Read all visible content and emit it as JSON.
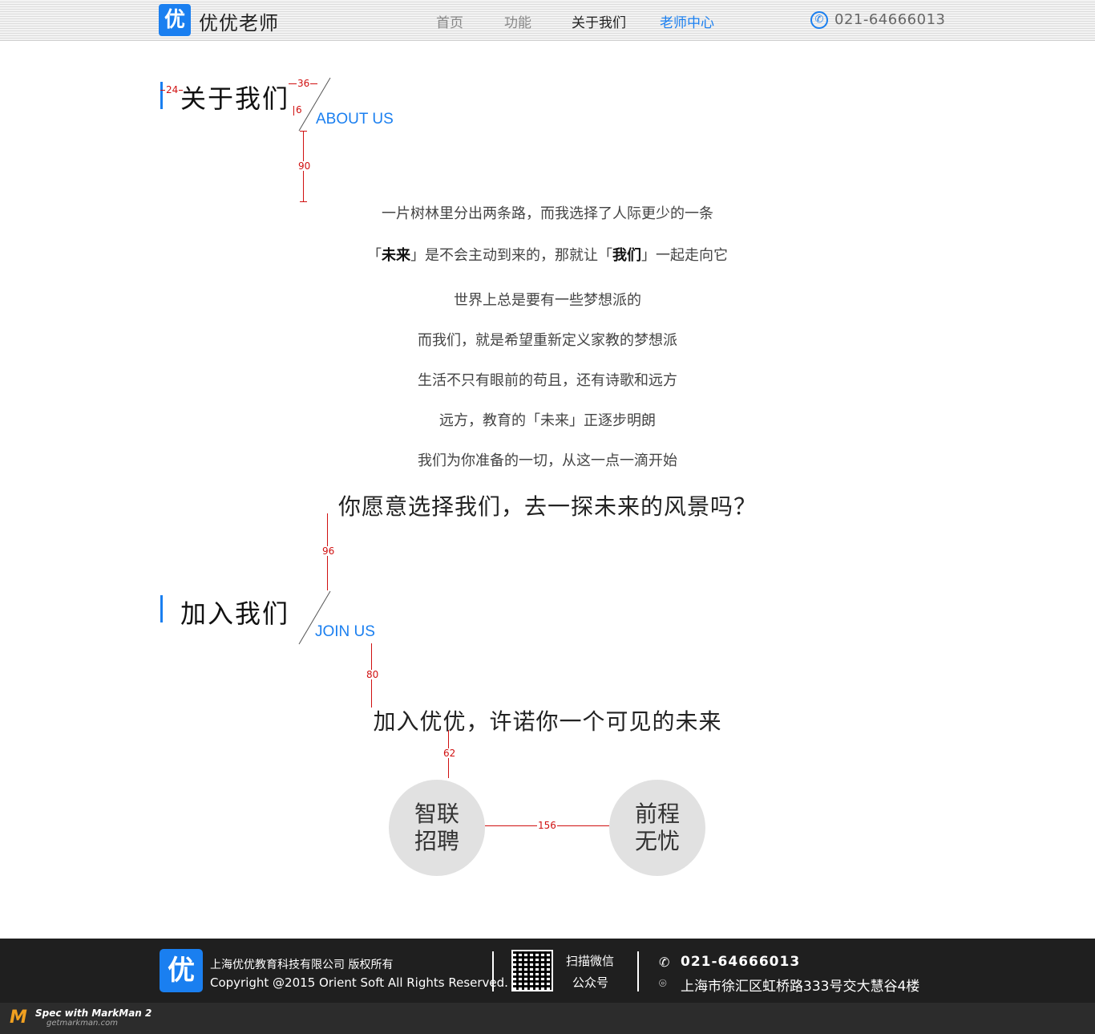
{
  "header": {
    "logo_glyph": "优",
    "brand": "优优老师",
    "nav": [
      "首页",
      "功能",
      "关于我们",
      "老师中心"
    ],
    "phone": "021-64666013"
  },
  "about": {
    "title": "关于我们",
    "subtitle": "ABOUT US",
    "lines": [
      "一片树林里分出两条路，而我选择了人际更少的一条",
      "世界上总是要有一些梦想派的",
      "而我们，就是希望重新定义家教的梦想派",
      "生活不只有眼前的苟且，还有诗歌和远方",
      "远方，教育的「未来」正逐步明朗",
      "我们为你准备的一切，从这一点一滴开始"
    ],
    "line2": {
      "p1": "「",
      "b1": "未来",
      "p2": "」是不会主动到来的，那就让「",
      "b2": "我们",
      "p3": "」一起走向它"
    },
    "question": "你愿意选择我们，去一探未来的风景吗？"
  },
  "join": {
    "title": "加入我们",
    "subtitle": "JOIN US",
    "slogan": "加入优优，许诺你一个可见的未来",
    "circles": [
      {
        "l1": "智联",
        "l2": "招聘"
      },
      {
        "l1": "前程",
        "l2": "无忧"
      }
    ]
  },
  "measures": {
    "m24": "24",
    "m36": "36",
    "m6": "6",
    "m90": "90",
    "m96": "96",
    "m80": "80",
    "m62": "62",
    "m156": "156"
  },
  "footer": {
    "logo_glyph": "优",
    "company": "上海优优教育科技有限公司 版权所有",
    "copyright": "Copyright @2015 Orient Soft All Rights Reserved.",
    "qr_l1": "扫描微信",
    "qr_l2": "公众号",
    "phone": "021-64666013",
    "address": "上海市徐汇区虹桥路333号交大慧谷4楼"
  },
  "markman": {
    "title": "Spec with MarkMan 2",
    "site": "getmarkman.com"
  },
  "colors": {
    "accent": "#1a7ff0",
    "measure": "#d01010",
    "footer_bg": "#1f1f1f"
  }
}
